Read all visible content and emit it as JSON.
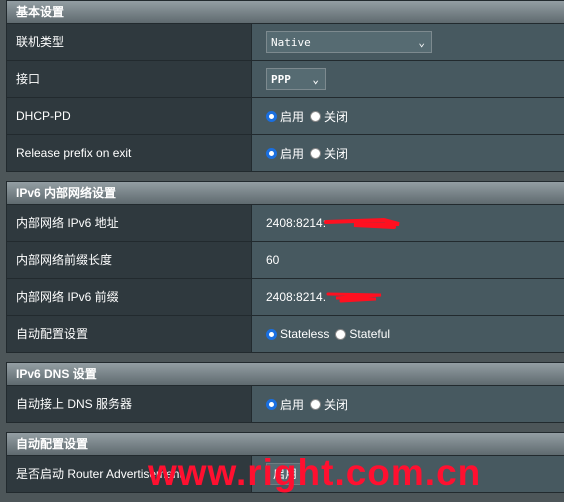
{
  "sections": [
    {
      "title": "基本设置",
      "rows": [
        {
          "label": "联机类型",
          "select": "Native"
        },
        {
          "label": "接口",
          "select": "PPP"
        },
        {
          "label": "DHCP-PD",
          "options": [
            "启用",
            "关闭"
          ],
          "selected": 0
        },
        {
          "label": "Release prefix on exit",
          "options": [
            "启用",
            "关闭"
          ],
          "selected": 0
        }
      ]
    },
    {
      "title": "IPv6 内部网络设置",
      "rows": [
        {
          "label": "内部网络 IPv6 地址",
          "value": "2408:8214:"
        },
        {
          "label": "内部网络前缀长度",
          "value": "60"
        },
        {
          "label": "内部网络 IPv6 前缀",
          "value": "2408:8214."
        },
        {
          "label": "自动配置设置",
          "options": [
            "Stateless",
            "Stateful"
          ],
          "selected": 0
        }
      ]
    },
    {
      "title": "IPv6 DNS 设置",
      "rows": [
        {
          "label": "自动接上 DNS 服务器",
          "options": [
            "启用",
            "关闭"
          ],
          "selected": 0
        }
      ]
    },
    {
      "title": "自动配置设置",
      "rows": [
        {
          "label": "是否启动 Router Advertisement",
          "select": "启用"
        }
      ]
    }
  ],
  "watermark": "www.right.com.cn",
  "colors": {
    "radio_selected": "#1a6fe0",
    "redaction": "#ff1020",
    "watermark": "#ff1030"
  }
}
